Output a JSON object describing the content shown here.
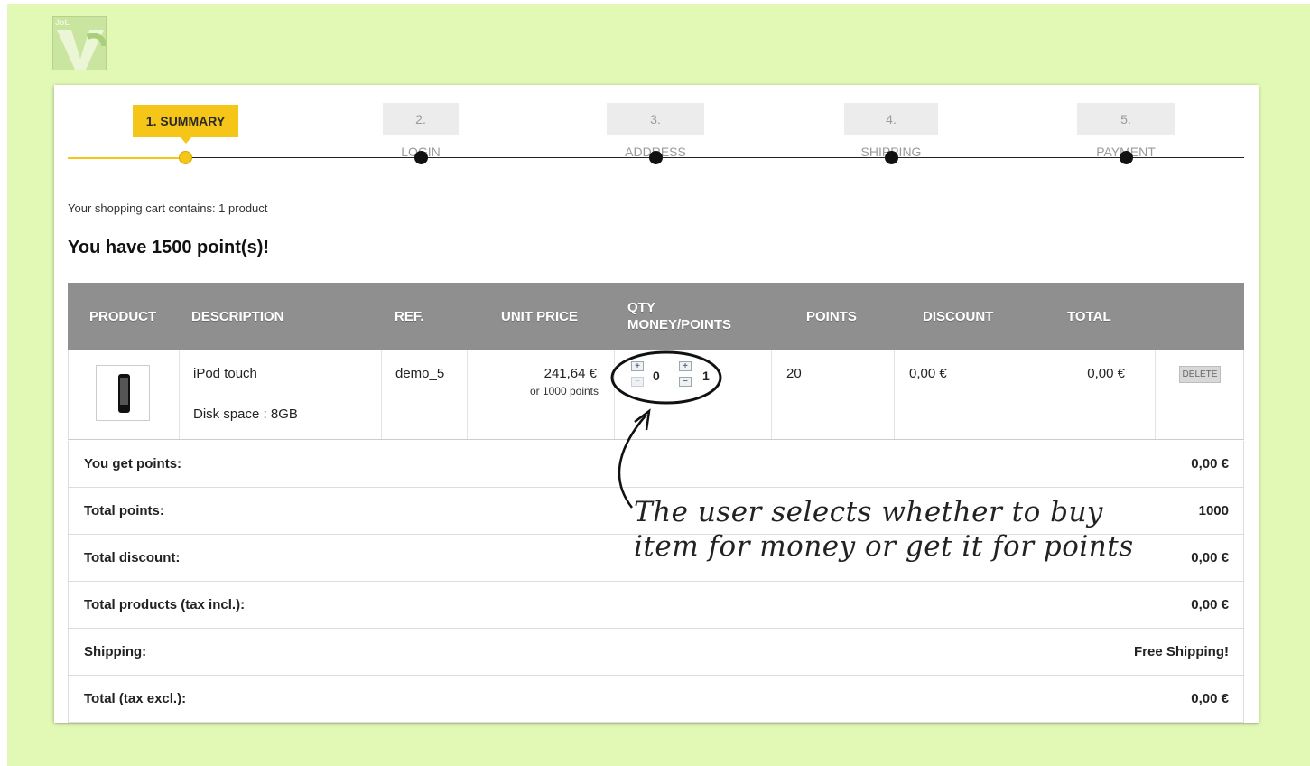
{
  "logo": {
    "text": "JoL"
  },
  "steps": [
    {
      "label": "1. SUMMARY",
      "active": true
    },
    {
      "label": "2. LOGIN",
      "active": false
    },
    {
      "label": "3. ADDRESS",
      "active": false
    },
    {
      "label": "4. SHIPPING",
      "active": false
    },
    {
      "label": "5. PAYMENT",
      "active": false
    }
  ],
  "cart": {
    "contains_text": "Your shopping cart contains: 1 product",
    "points_text": "You have 1500 point(s)!"
  },
  "table": {
    "headers": {
      "product": "PRODUCT",
      "description": "DESCRIPTION",
      "ref": "REF.",
      "unit_price": "UNIT PRICE",
      "qty_line1": "QTY",
      "qty_line2": "MONEY/POINTS",
      "points": "POINTS",
      "discount": "DISCOUNT",
      "total": "TOTAL"
    },
    "row": {
      "name": "iPod touch",
      "attribute": "Disk space : 8GB",
      "ref": "demo_5",
      "unit_price": "241,64 €",
      "price_points": "or 1000 points",
      "qty_money": "0",
      "qty_points": "1",
      "points": "20",
      "discount": "0,00 €",
      "total": "0,00 €",
      "delete_label": "DELETE",
      "plus_symbol": "+",
      "minus_symbol": "−"
    }
  },
  "summary": [
    {
      "label": "You get points:",
      "value": "0,00 €"
    },
    {
      "label": "Total points:",
      "value": "1000"
    },
    {
      "label": "Total discount:",
      "value": "0,00 €"
    },
    {
      "label": "Total products (tax incl.):",
      "value": "0,00 €"
    },
    {
      "label": "Shipping:",
      "value": "Free Shipping!"
    },
    {
      "label": "Total (tax excl.):",
      "value": "0,00 €"
    }
  ],
  "annotation": {
    "line1": "The user selects whether to buy",
    "line2": "item for money or get it for points"
  },
  "colors": {
    "background": "#e2f9b6",
    "active_step": "#f5c518",
    "header": "#8f8f8f"
  }
}
